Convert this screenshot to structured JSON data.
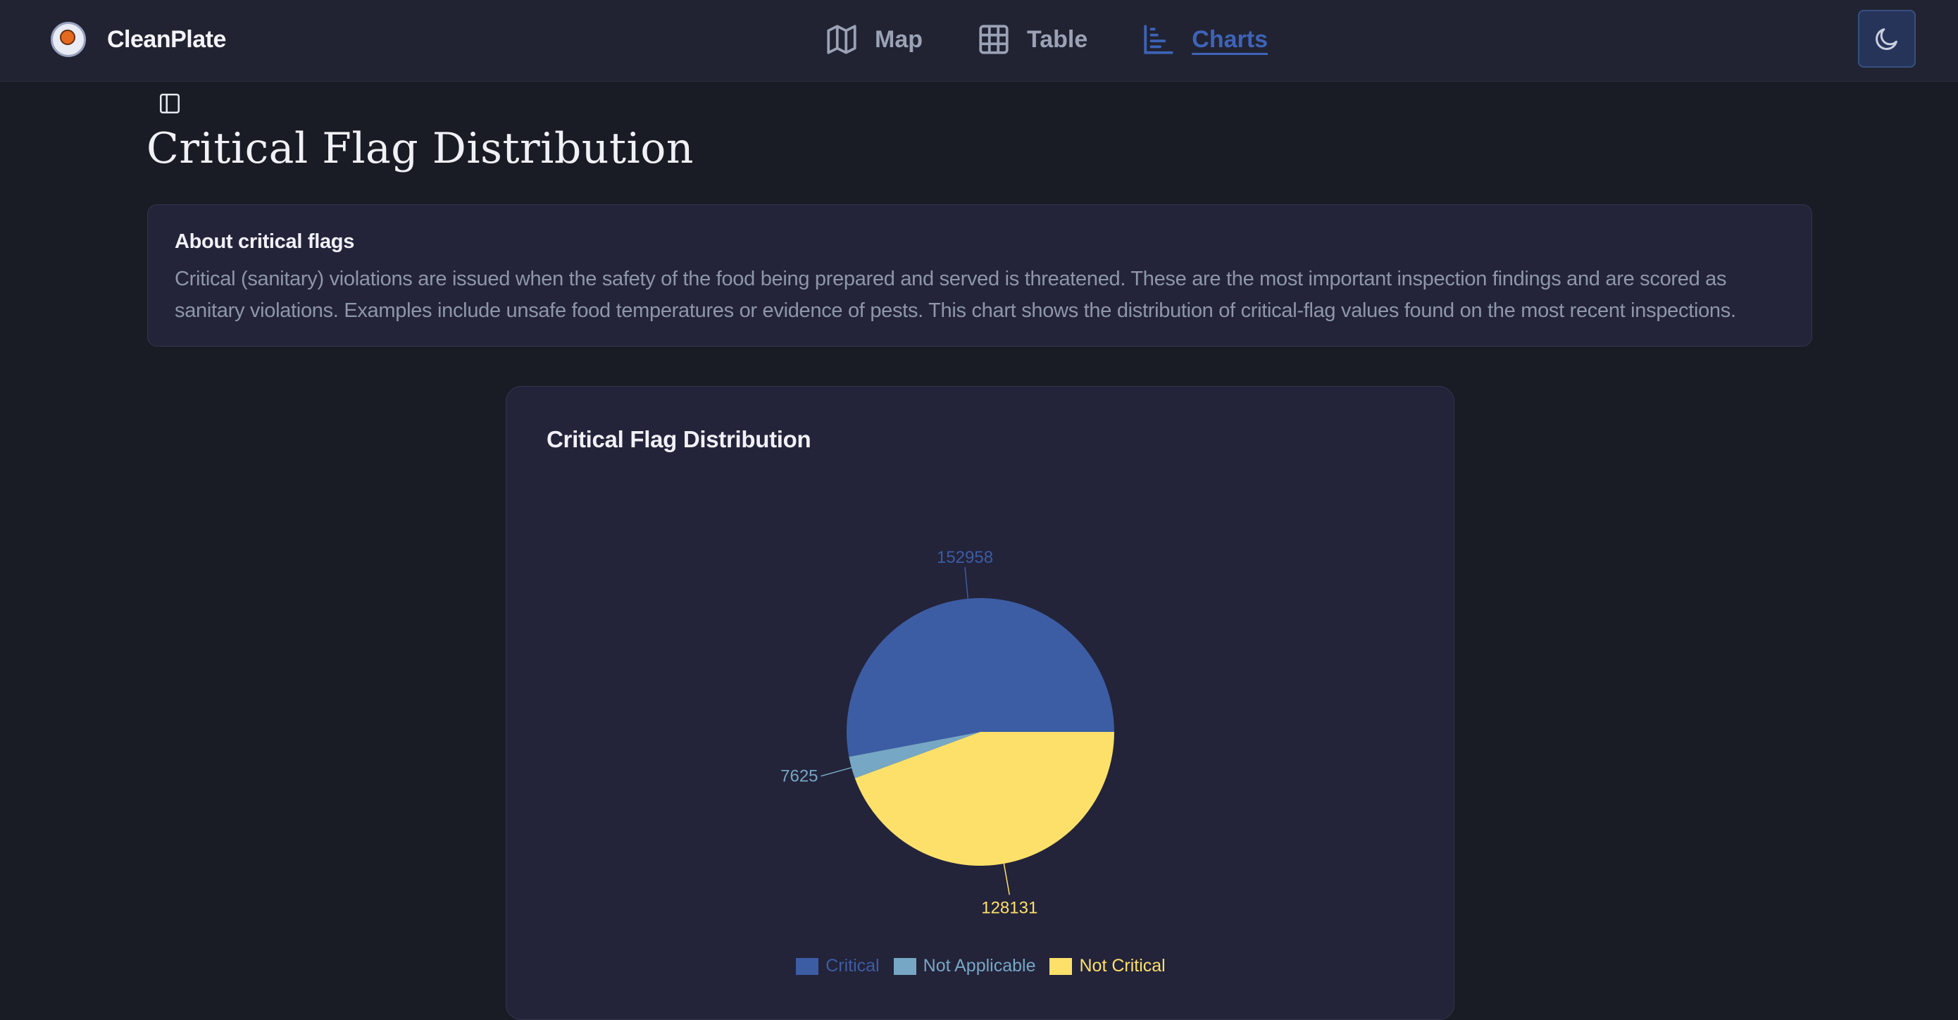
{
  "app": {
    "name": "CleanPlate"
  },
  "nav": {
    "items": [
      {
        "label": "Map",
        "icon": "map-icon",
        "active": false
      },
      {
        "label": "Table",
        "icon": "table-icon",
        "active": false
      },
      {
        "label": "Charts",
        "icon": "bar-chart-icon",
        "active": true
      }
    ]
  },
  "header": {
    "theme_toggle_icon": "moon-icon",
    "sidebar_toggle_icon": "sidebar-icon"
  },
  "page": {
    "title": "Critical Flag Distribution"
  },
  "about": {
    "title": "About critical flags",
    "text": "Critical (sanitary) violations are issued when the safety of the food being prepared and served is threatened. These are the most important inspection findings and are scored as sanitary violations. Examples include unsafe food temperatures or evidence of pests. This chart shows the distribution of critical-flag values found on the most recent inspections."
  },
  "chart_card": {
    "title": "Critical Flag Distribution"
  },
  "colors": {
    "accent": "#3e63b8",
    "critical": "#3c5da4",
    "not_applicable": "#76a7c4",
    "not_critical": "#fde06a"
  },
  "chart_data": {
    "type": "pie",
    "title": "Critical Flag Distribution",
    "categories": [
      "Critical",
      "Not Applicable",
      "Not Critical"
    ],
    "values": [
      152958,
      7625,
      128131
    ],
    "colors": [
      "#3c5da4",
      "#76a7c4",
      "#fde06a"
    ],
    "legend": "bottom"
  }
}
